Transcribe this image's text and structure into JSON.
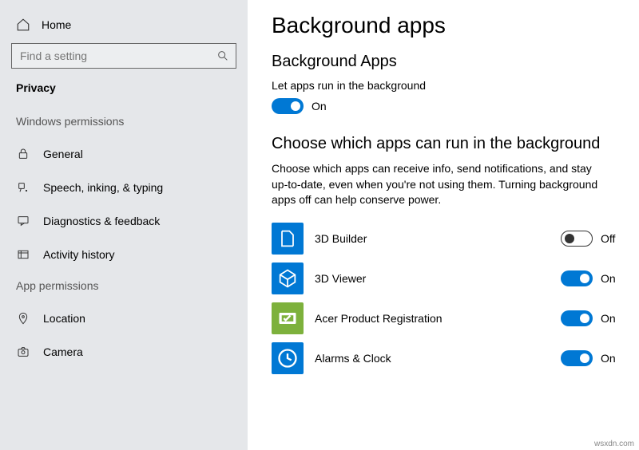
{
  "sidebar": {
    "home": "Home",
    "search_placeholder": "Find a setting",
    "category": "Privacy",
    "sections": {
      "windows": "Windows permissions",
      "app": "App permissions"
    },
    "items": [
      {
        "label": "General"
      },
      {
        "label": "Speech, inking, & typing"
      },
      {
        "label": "Diagnostics & feedback"
      },
      {
        "label": "Activity history"
      }
    ],
    "items2": [
      {
        "label": "Location"
      },
      {
        "label": "Camera"
      }
    ]
  },
  "main": {
    "title": "Background apps",
    "subtitle": "Background Apps",
    "master_label": "Let apps run in the background",
    "master_state": "On",
    "section_title": "Choose which apps can run in the background",
    "section_desc": "Choose which apps can receive info, send notifications, and stay up-to-date, even when you're not using them. Turning background apps off can help conserve power.",
    "apps": [
      {
        "name": "3D Builder",
        "state": "Off",
        "on": false,
        "color": "#0078d4"
      },
      {
        "name": "3D Viewer",
        "state": "On",
        "on": true,
        "color": "#0078d4"
      },
      {
        "name": "Acer Product Registration",
        "state": "On",
        "on": true,
        "color": "#7db13c"
      },
      {
        "name": "Alarms & Clock",
        "state": "On",
        "on": true,
        "color": "#0078d4"
      }
    ]
  },
  "watermark": "wsxdn.com"
}
